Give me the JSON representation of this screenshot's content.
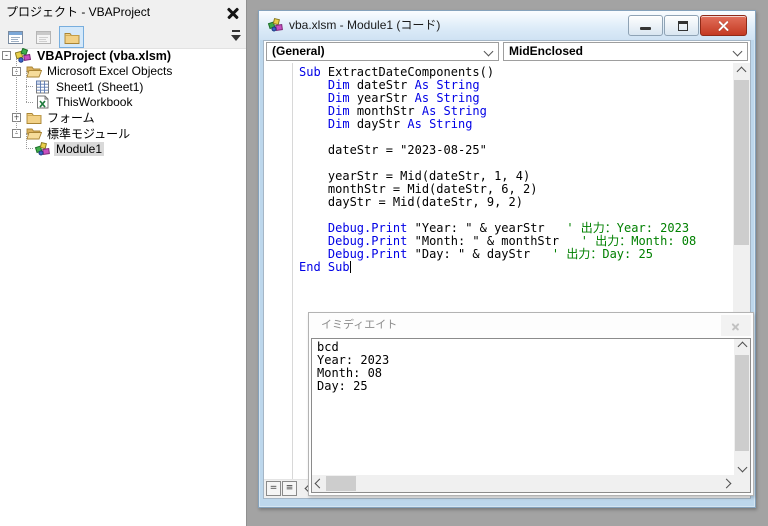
{
  "colors": {
    "keyword": "#0000E6",
    "comment": "#008000",
    "plain": "#000000",
    "close_button_red": "#c43a22",
    "window_frame_blue": "#bdd7ec",
    "mdi_background": "#a3a3a3",
    "tree_selection": "#d9d9d9",
    "folder_yellow": "#f2d186"
  },
  "project_explorer": {
    "title": "プロジェクト - VBAProject",
    "close_icon": "x-icon",
    "toolbar": {
      "buttons": [
        {
          "name": "view-code",
          "active": false
        },
        {
          "name": "view-object",
          "active": false
        },
        {
          "name": "toggle-folders",
          "active": true
        }
      ],
      "overflow_icon": "dropdown-overflow"
    },
    "tree": [
      {
        "label": "VBAProject (vba.xlsm)",
        "level": 1,
        "expander": "-",
        "icon": "vba-project",
        "bold": true,
        "selected": false
      },
      {
        "label": "Microsoft Excel Objects",
        "level": 2,
        "expander": "-",
        "icon": "folder-open",
        "bold": false,
        "selected": false
      },
      {
        "label": "Sheet1 (Sheet1)",
        "level": 3,
        "expander": null,
        "icon": "worksheet",
        "bold": false,
        "selected": false
      },
      {
        "label": "ThisWorkbook",
        "level": 3,
        "expander": null,
        "icon": "workbook",
        "bold": false,
        "selected": false
      },
      {
        "label": "フォーム",
        "level": 2,
        "expander": "+",
        "icon": "folder-closed",
        "bold": false,
        "selected": false
      },
      {
        "label": "標準モジュール",
        "level": 2,
        "expander": "-",
        "icon": "folder-open",
        "bold": false,
        "selected": false
      },
      {
        "label": "Module1",
        "level": 3,
        "expander": null,
        "icon": "module",
        "bold": false,
        "selected": true
      }
    ]
  },
  "code_window": {
    "title": "vba.xlsm - Module1 (コード)",
    "title_icon": "module",
    "object_dropdown": "(General)",
    "procedure_dropdown": "MidEnclosed",
    "window_buttons": [
      "minimize-icon",
      "restore-icon",
      "close-icon"
    ],
    "code_lines": [
      {
        "tokens": [
          [
            "Sub",
            "k"
          ],
          [
            " ExtractDateComponents()",
            "p"
          ]
        ]
      },
      {
        "tokens": [
          [
            "    ",
            "p"
          ],
          [
            "Dim",
            "k"
          ],
          [
            " dateStr ",
            "p"
          ],
          [
            "As",
            "k"
          ],
          [
            " ",
            "p"
          ],
          [
            "String",
            "k"
          ]
        ]
      },
      {
        "tokens": [
          [
            "    ",
            "p"
          ],
          [
            "Dim",
            "k"
          ],
          [
            " yearStr ",
            "p"
          ],
          [
            "As",
            "k"
          ],
          [
            " ",
            "p"
          ],
          [
            "String",
            "k"
          ]
        ]
      },
      {
        "tokens": [
          [
            "    ",
            "p"
          ],
          [
            "Dim",
            "k"
          ],
          [
            " monthStr ",
            "p"
          ],
          [
            "As",
            "k"
          ],
          [
            " ",
            "p"
          ],
          [
            "String",
            "k"
          ]
        ]
      },
      {
        "tokens": [
          [
            "    ",
            "p"
          ],
          [
            "Dim",
            "k"
          ],
          [
            " dayStr ",
            "p"
          ],
          [
            "As",
            "k"
          ],
          [
            " ",
            "p"
          ],
          [
            "String",
            "k"
          ]
        ]
      },
      {
        "tokens": []
      },
      {
        "tokens": [
          [
            "    dateStr = \"2023-08-25\"",
            "p"
          ]
        ]
      },
      {
        "tokens": []
      },
      {
        "tokens": [
          [
            "    yearStr = Mid(dateStr, 1, 4)",
            "p"
          ]
        ]
      },
      {
        "tokens": [
          [
            "    monthStr = Mid(dateStr, 6, 2)",
            "p"
          ]
        ]
      },
      {
        "tokens": [
          [
            "    dayStr = Mid(dateStr, 9, 2)",
            "p"
          ]
        ]
      },
      {
        "tokens": []
      },
      {
        "tokens": [
          [
            "    ",
            "p"
          ],
          [
            "Debug.Print",
            "k"
          ],
          [
            " \"Year: \" & yearStr   ",
            "p"
          ],
          [
            "' 出力：Year: 2023",
            "c"
          ]
        ]
      },
      {
        "tokens": [
          [
            "    ",
            "p"
          ],
          [
            "Debug.Print",
            "k"
          ],
          [
            " \"Month: \" & monthStr   ",
            "p"
          ],
          [
            "' 出力：Month: 08",
            "c"
          ]
        ]
      },
      {
        "tokens": [
          [
            "    ",
            "p"
          ],
          [
            "Debug.Print",
            "k"
          ],
          [
            " \"Day: \" & dayStr   ",
            "p"
          ],
          [
            "' 出力：Day: 25",
            "c"
          ]
        ]
      },
      {
        "tokens": [
          [
            "End Sub",
            "k"
          ]
        ],
        "caret": true
      }
    ]
  },
  "immediate_window": {
    "title": "イミディエイト",
    "close_icon": "x-icon",
    "lines": [
      "bcd",
      "Year: 2023",
      "Month: 08",
      "Day: 25"
    ]
  }
}
